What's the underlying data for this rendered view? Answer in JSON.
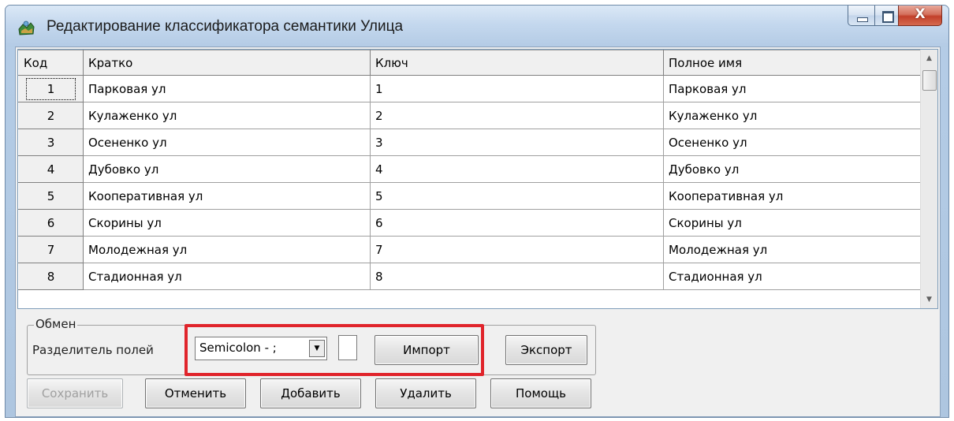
{
  "window": {
    "title": "Редактирование классификатора семантики Улица",
    "close_glyph": "X"
  },
  "table": {
    "columns": [
      "Код",
      "Кратко",
      "Ключ",
      "Полное имя"
    ],
    "rows": [
      {
        "code": "1",
        "short": "Парковая ул",
        "key": "1",
        "full": "Парковая ул"
      },
      {
        "code": "2",
        "short": "Кулаженко ул",
        "key": "2",
        "full": "Кулаженко ул"
      },
      {
        "code": "3",
        "short": "Осененко ул",
        "key": "3",
        "full": "Осененко ул"
      },
      {
        "code": "4",
        "short": "Дубовко ул",
        "key": "4",
        "full": "Дубовко ул"
      },
      {
        "code": "5",
        "short": "Кооперативная ул",
        "key": "5",
        "full": "Кооперативная ул"
      },
      {
        "code": "6",
        "short": "Скорины ул",
        "key": "6",
        "full": "Скорины ул"
      },
      {
        "code": "7",
        "short": "Молодежная ул",
        "key": "7",
        "full": "Молодежная ул"
      },
      {
        "code": "8",
        "short": "Стадионная ул",
        "key": "8",
        "full": "Стадионная ул"
      }
    ]
  },
  "exchange": {
    "legend": "Обмен",
    "separator_label": "Разделитель полей",
    "separator_value": "Semicolon - ;",
    "import_label": "Импорт",
    "export_label": "Экспорт"
  },
  "buttons": {
    "save": "Сохранить",
    "cancel": "Отменить",
    "add": "Добавить",
    "delete": "Удалить",
    "help": "Помощь"
  },
  "colors": {
    "highlight": "#e0242b"
  }
}
